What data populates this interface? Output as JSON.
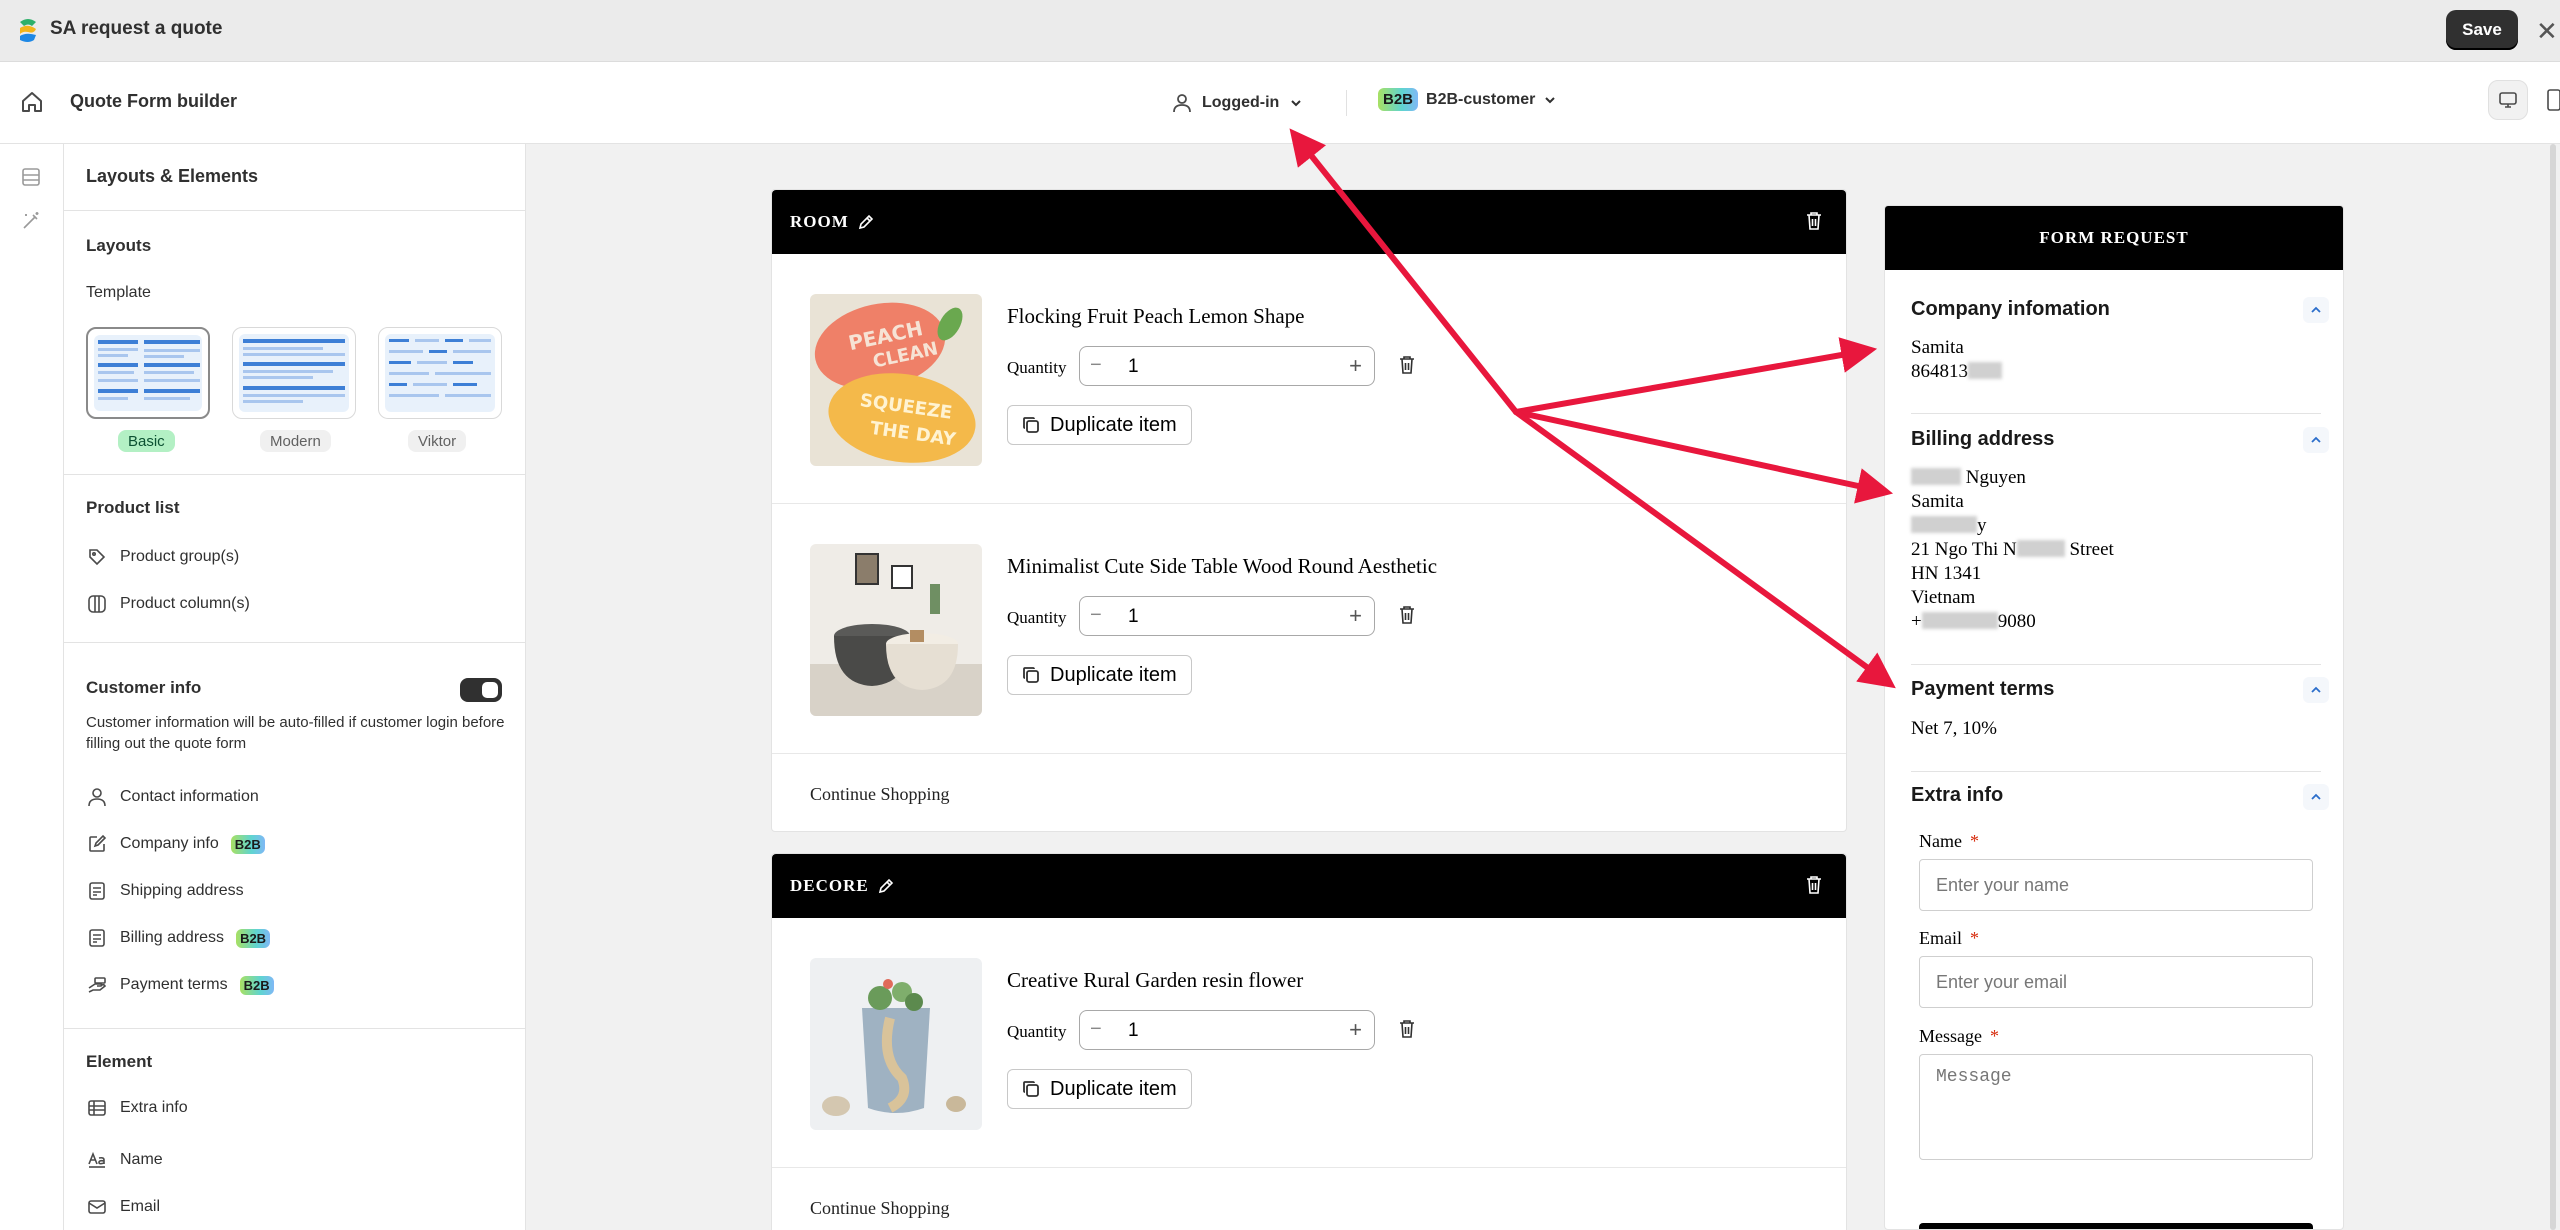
{
  "app": {
    "title": "SA request a quote",
    "save_label": "Save"
  },
  "toolbar": {
    "builder_title": "Quote Form builder",
    "login_state": "Logged-in",
    "b2b_tag": "B2B",
    "customer_type": "B2B-customer"
  },
  "sidebar": {
    "heading": "Layouts & Elements",
    "layouts": {
      "title": "Layouts",
      "template_label": "Template",
      "templates": [
        {
          "name": "Basic",
          "selected": true
        },
        {
          "name": "Modern",
          "selected": false
        },
        {
          "name": "Viktor",
          "selected": false
        }
      ]
    },
    "product_list": {
      "title": "Product list",
      "items": [
        {
          "label": "Product group(s)",
          "icon": "tag-group-icon"
        },
        {
          "label": "Product column(s)",
          "icon": "columns-icon"
        }
      ]
    },
    "customer_info": {
      "title": "Customer info",
      "toggle_on": true,
      "description": "Customer information will be auto-filled if customer login before filling out the quote form",
      "items": [
        {
          "label": "Contact information",
          "icon": "person-icon",
          "b2b": false
        },
        {
          "label": "Company info",
          "icon": "edit-icon",
          "b2b": true
        },
        {
          "label": "Shipping address",
          "icon": "receipt-icon",
          "b2b": false
        },
        {
          "label": "Billing address",
          "icon": "receipt-icon",
          "b2b": true
        },
        {
          "label": "Payment terms",
          "icon": "cash-icon",
          "b2b": true
        }
      ],
      "b2b_tag": "B2B"
    },
    "element": {
      "title": "Element",
      "items": [
        {
          "label": "Extra info",
          "icon": "table-icon"
        },
        {
          "label": "Name",
          "icon": "text-icon"
        },
        {
          "label": "Email",
          "icon": "mail-icon"
        }
      ]
    }
  },
  "sections": [
    {
      "name": "ROOM",
      "products": [
        {
          "title": "Flocking Fruit Peach Lemon Shape",
          "quantity": "1",
          "image": "peach-lemon-rug"
        },
        {
          "title": "Minimalist Cute Side Table Wood Round Aesthetic",
          "quantity": "1",
          "image": "side-table"
        }
      ],
      "continue_label": "Continue Shopping"
    },
    {
      "name": "DECORE",
      "products": [
        {
          "title": "Creative Rural Garden resin flower",
          "quantity": "1",
          "image": "resin-planter"
        }
      ],
      "continue_label": "Continue Shopping"
    }
  ],
  "labels": {
    "quantity": "Quantity",
    "duplicate": "Duplicate item"
  },
  "form": {
    "header": "FORM REQUEST",
    "company": {
      "title": "Company infomation",
      "line1": "Samita",
      "line2": "864813"
    },
    "billing": {
      "title": "Billing address",
      "name": "Nguyen",
      "company": "Samita",
      "city_tail": "y",
      "street_start": "21 Ngo Thi N",
      "street_end": "Street",
      "line4": "HN 1341",
      "line5": "Vietnam",
      "phone_start": "+",
      "phone_end": "9080"
    },
    "payment": {
      "title": "Payment terms",
      "value": "Net 7, 10%"
    },
    "extra": {
      "title": "Extra info",
      "name_label": "Name",
      "name_placeholder": "Enter your name",
      "email_label": "Email",
      "email_placeholder": "Enter your email",
      "message_label": "Message",
      "message_placeholder": "Message",
      "required_mark": "*"
    }
  },
  "colors": {
    "accent_arrow": "#e8173d",
    "header_black": "#000000",
    "b2b_gradient": [
      "#a8e063",
      "#5fd4d0",
      "#7fb8f5"
    ],
    "selected_template": "#b3f0c4"
  }
}
